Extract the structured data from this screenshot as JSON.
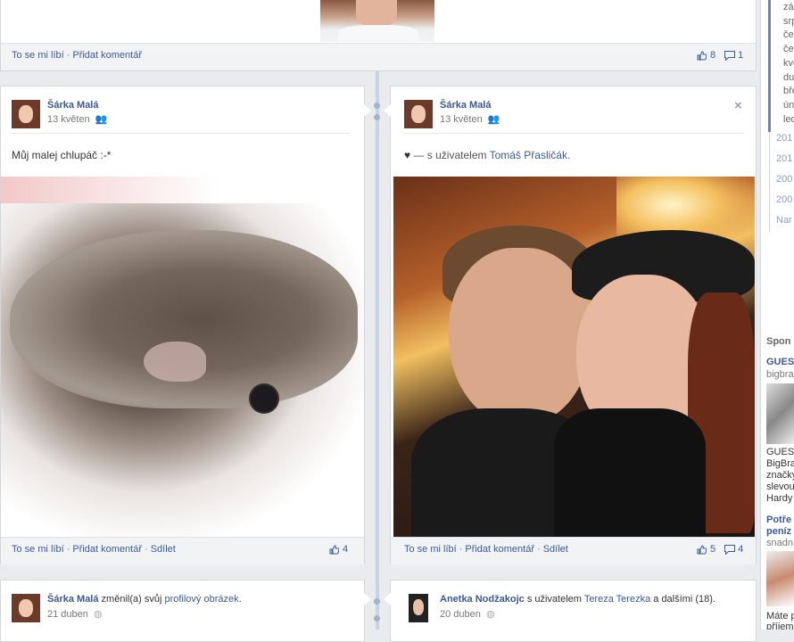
{
  "top_post": {
    "like_label": "To se mi líbí",
    "comment_label": "Přidat komentář",
    "likes": "8",
    "comments": "1"
  },
  "posts": [
    {
      "author": "Šárka Malá",
      "date": "13 květen",
      "text": "Můj malej chlupáč :-*",
      "like_label": "To se mi líbí",
      "comment_label": "Přidat komentář",
      "share_label": "Sdílet",
      "likes": "4"
    },
    {
      "author": "Šárka Malá",
      "date": "13 květen",
      "heart": "♥",
      "with_text": "— s uživatelem",
      "tagged": "Tomáš Přasličák",
      "like_label": "To se mi líbí",
      "comment_label": "Přidat komentář",
      "share_label": "Sdílet",
      "likes": "5",
      "comments": "4"
    },
    {
      "author": "Šárka Malá",
      "action": "změnil(a) svůj",
      "action_link": "profilový obrázek",
      "date": "21 duben"
    },
    {
      "author": "Anetka Nodžakojc",
      "with_text": "s uživatelem",
      "tagged": "Tereza Terezka",
      "rest": "a dalšími (18).",
      "date": "20 duben"
    }
  ],
  "right_column": {
    "month_items": [
      "zář",
      "srp",
      "čer",
      "čer",
      "kve",
      "dub",
      "bře",
      "úno",
      "led"
    ],
    "year_items": [
      "201",
      "201",
      "200",
      "200",
      "Nar"
    ],
    "sponsored": "Spon",
    "ads": [
      {
        "title": "GUES",
        "sub": "bigbra",
        "body": [
          "GUESS",
          "BigBra",
          "značky",
          "slevou",
          "Hardy"
        ]
      },
      {
        "title": "Potře",
        "title2": "peníz",
        "sub": "snadn",
        "body": [
          "Máte p",
          "příjem"
        ]
      }
    ]
  },
  "colors": {
    "link": "#3b5998",
    "timeline": "#c9d3e4",
    "background": "#e9ebee"
  }
}
